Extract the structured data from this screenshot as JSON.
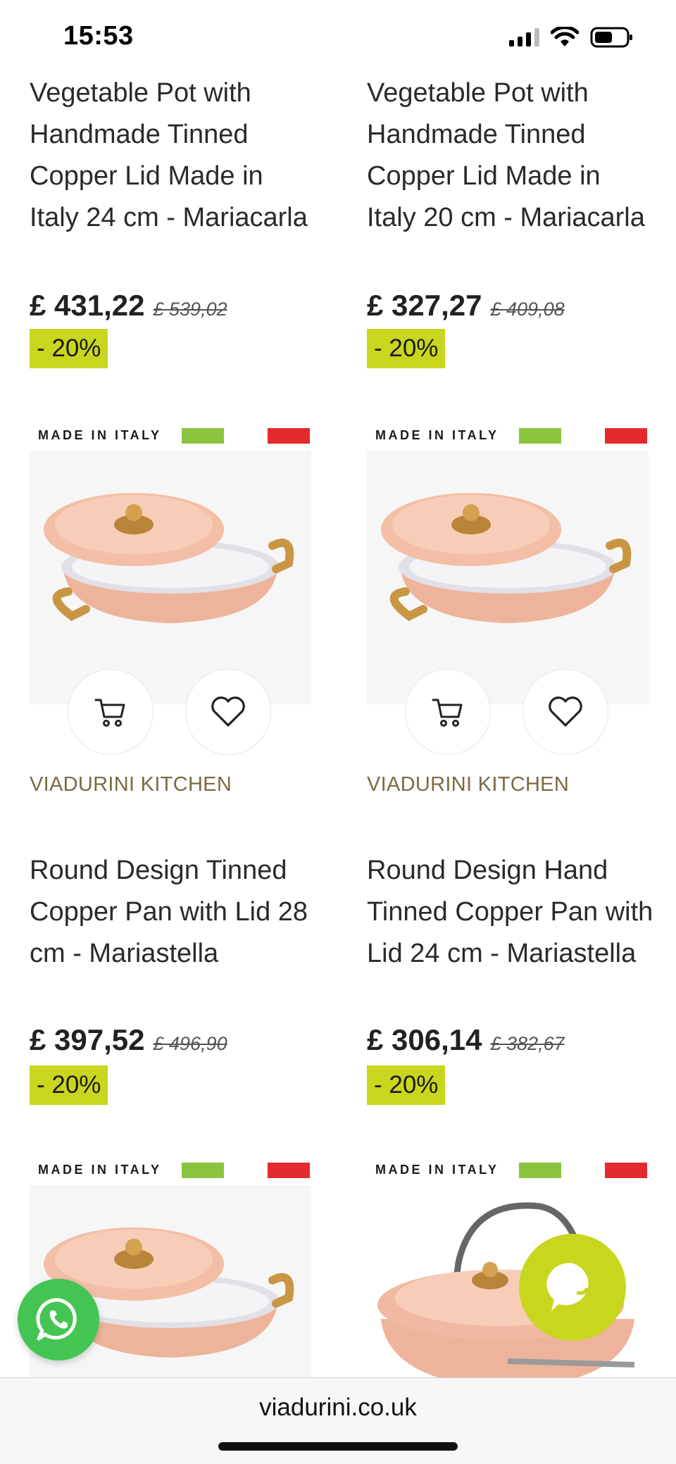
{
  "status_bar": {
    "time": "15:53"
  },
  "products": [
    {
      "title": "Vegetable Pot with Handmade Tinned Copper Lid Made in Italy 24 cm - Mariacarla",
      "price": "£ 431,22",
      "old_price": "£ 539,02",
      "discount": "- 20%"
    },
    {
      "title": "Vegetable Pot with Handmade Tinned Copper Lid Made in Italy 20 cm - Mariacarla",
      "price": "£ 327,27",
      "old_price": "£ 409,08",
      "discount": "- 20%"
    },
    {
      "made_in_italy": "MADE IN ITALY",
      "brand": "VIADURINI KITCHEN",
      "title": "Round Design Tinned Copper Pan with Lid 28 cm - Mariastella",
      "price": "£ 397,52",
      "old_price": "£ 496,90",
      "discount": "- 20%"
    },
    {
      "made_in_italy": "MADE IN ITALY",
      "brand": "VIADURINI KITCHEN",
      "title": "Round Design Hand Tinned Copper Pan with Lid 24 cm - Mariastella",
      "price": "£ 306,14",
      "old_price": "£ 382,67",
      "discount": "- 20%"
    },
    {
      "made_in_italy": "MADE IN ITALY"
    },
    {
      "made_in_italy": "MADE IN ITALY"
    }
  ],
  "icons": {
    "cart": "cart-icon",
    "wishlist": "heart-icon",
    "whatsapp": "whatsapp-icon",
    "chat": "chat-icon"
  },
  "colors": {
    "badge": "#c8d61e",
    "brand": "#7a6a45",
    "copper": "#f0b49a",
    "flag_green": "#8bc43f",
    "flag_red": "#e42a2d",
    "whatsapp": "#44c553"
  },
  "browser": {
    "url": "viadurini.co.uk"
  }
}
